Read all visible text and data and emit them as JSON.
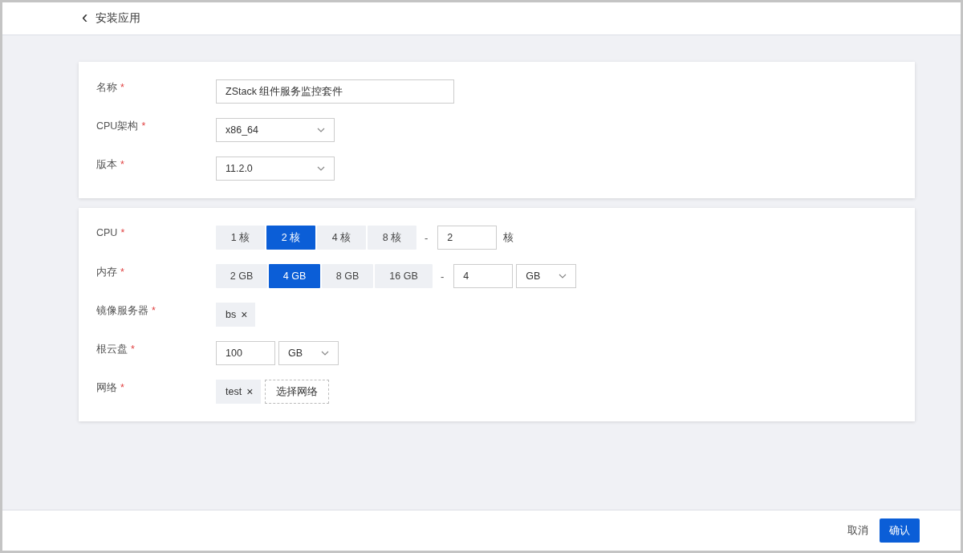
{
  "header": {
    "back": "‹",
    "title": "安装应用"
  },
  "cards": [
    {
      "fields": [
        {
          "kind": "text",
          "label": "名称",
          "mark": "*",
          "value": "ZStack 组件服务监控套件"
        },
        {
          "kind": "select",
          "label": "CPU架构",
          "mark": "*",
          "value": "x86_64"
        },
        {
          "kind": "select",
          "label": "版本",
          "mark": "*",
          "value": "11.2.0"
        }
      ]
    },
    {
      "fields": [
        {
          "kind": "choice",
          "label": "CPU",
          "mark": "*",
          "options": [
            {
              "label": "1 核",
              "selected": false
            },
            {
              "label": "2 核",
              "selected": true
            },
            {
              "label": "4 核",
              "selected": false
            },
            {
              "label": "8 核",
              "selected": false
            }
          ],
          "separator": "-",
          "value": "2",
          "unit": {
            "kind": "text",
            "label": "核"
          }
        },
        {
          "kind": "choice",
          "label": "内存",
          "mark": "*",
          "options": [
            {
              "label": "2 GB",
              "selected": false
            },
            {
              "label": "4 GB",
              "selected": true
            },
            {
              "label": "8 GB",
              "selected": false
            },
            {
              "label": "16 GB",
              "selected": false
            }
          ],
          "separator": "-",
          "value": "4",
          "unit": {
            "kind": "select",
            "value": "GB"
          }
        },
        {
          "kind": "tags",
          "label": "镜像服务器",
          "mark": "*",
          "tags": [
            {
              "label": "bs",
              "remove": "×"
            }
          ]
        },
        {
          "kind": "size",
          "label": "根云盘",
          "mark": "*",
          "value": "100",
          "unit": {
            "kind": "select",
            "value": "GB"
          }
        },
        {
          "kind": "tags",
          "label": "网络",
          "mark": "*",
          "tags": [
            {
              "label": "test",
              "remove": "×"
            }
          ],
          "picker": "选择网络"
        }
      ]
    }
  ],
  "footer": {
    "cancel": "取消",
    "confirm": "确认"
  }
}
